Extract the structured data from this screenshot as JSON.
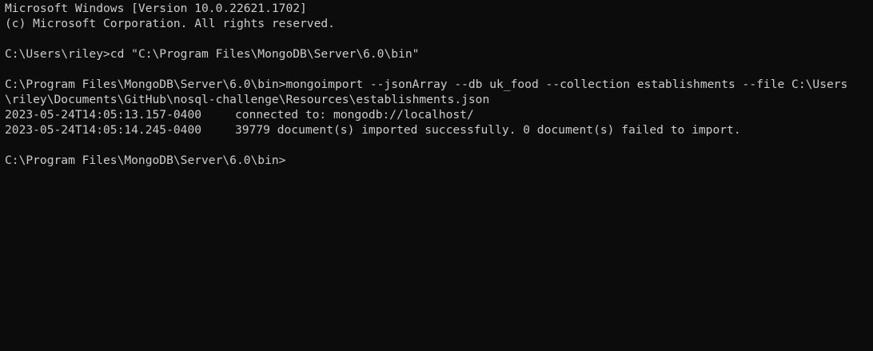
{
  "terminal": {
    "header_line1": "Microsoft Windows [Version 10.0.22621.1702]",
    "header_line2": "(c) Microsoft Corporation. All rights reserved.",
    "cmd1": {
      "prompt": "C:\\Users\\riley>",
      "command": "cd \"C:\\Program Files\\MongoDB\\Server\\6.0\\bin\""
    },
    "cmd2": {
      "prompt": "C:\\Program Files\\MongoDB\\Server\\6.0\\bin>",
      "command_part1": "mongoimport --jsonArray --db uk_food --collection establishments --file C:\\Users",
      "command_part2": "\\riley\\Documents\\GitHub\\nosql-challenge\\Resources\\establishments.json"
    },
    "log": [
      {
        "timestamp": "2023-05-24T14:05:13.157-0400",
        "message": "connected to: mongodb://localhost/"
      },
      {
        "timestamp": "2023-05-24T14:05:14.245-0400",
        "message": "39779 document(s) imported successfully. 0 document(s) failed to import."
      }
    ],
    "final_prompt": "C:\\Program Files\\MongoDB\\Server\\6.0\\bin>",
    "colors": {
      "background": "#0c0c0c",
      "text": "#cccccc"
    }
  }
}
